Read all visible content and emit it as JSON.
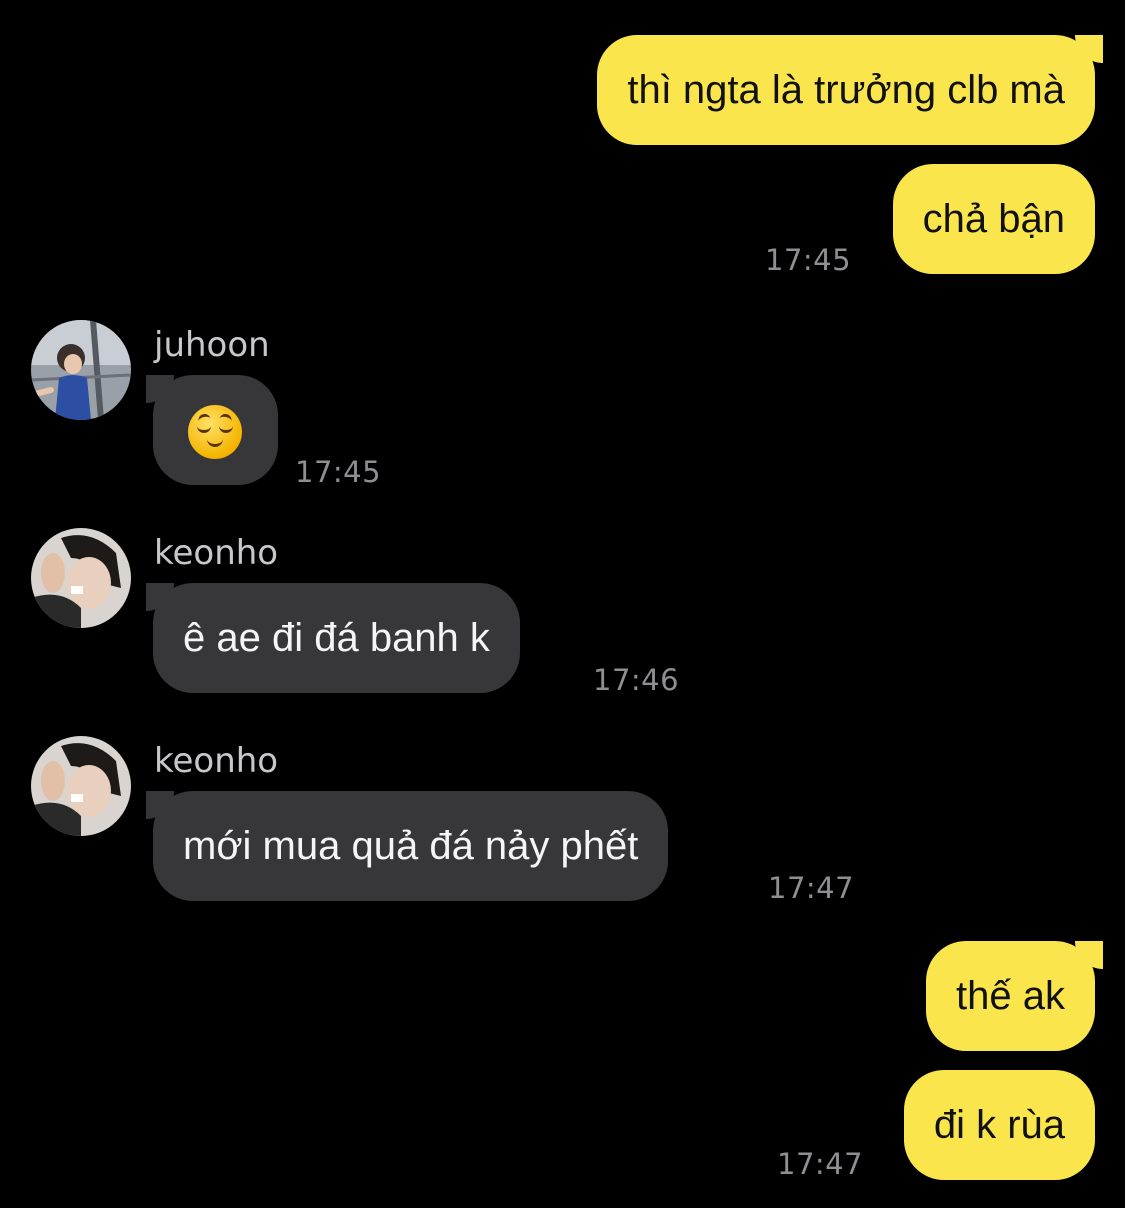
{
  "messages": [
    {
      "sender": "",
      "text": "thì ngta là trưởng clb mà",
      "time": ""
    },
    {
      "sender": "",
      "text": "chả bận",
      "time": "17:45"
    },
    {
      "sender": "juhoon",
      "text": "",
      "emoji": "relieved-face",
      "time": "17:45"
    },
    {
      "sender": "keonho",
      "text": "ê ae đi đá banh k",
      "time": "17:46"
    },
    {
      "sender": "keonho",
      "text": "mới mua quả đá nảy phết",
      "time": "17:47"
    },
    {
      "sender": "",
      "text": "thế ak",
      "time": ""
    },
    {
      "sender": "",
      "text": "đi k rùa",
      "time": "17:47"
    }
  ],
  "colors": {
    "background": "#000000",
    "outgoing_bubble": "#FAE64C",
    "incoming_bubble": "#373739",
    "timestamp": "#8e8e93",
    "sender_name": "#c8c8cc"
  }
}
